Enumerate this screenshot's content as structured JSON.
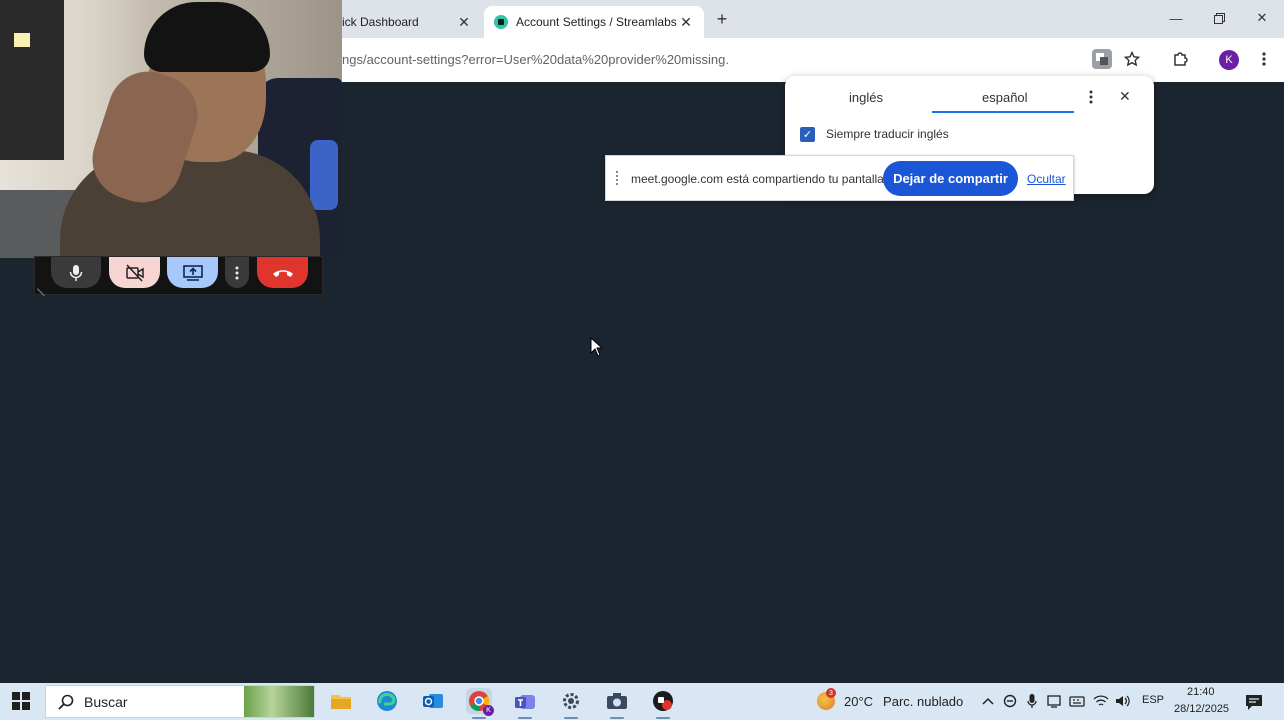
{
  "browser": {
    "tabs": [
      {
        "label": "ick Dashboard",
        "active": false
      },
      {
        "label": "Account Settings / Streamlabs",
        "active": true
      }
    ],
    "url": "ngs/account-settings?error=User%20data%20provider%20missing.",
    "avatar_letter": "K"
  },
  "translate_popup": {
    "source_lang": "inglés",
    "target_lang": "español",
    "always_translate_label": "Siempre traducir inglés",
    "always_translate_checked": true
  },
  "share_bar": {
    "message": "meet.google.com está compartiendo tu pantalla.",
    "stop_label": "Dejar de compartir",
    "hide_label": "Ocultar"
  },
  "taskbar": {
    "search_placeholder": "Buscar",
    "weather_temp": "20°C",
    "weather_condition": "Parc. nublado",
    "weather_badge": "3",
    "language": "ESP",
    "time": "21:40",
    "date": "28/12/2025"
  },
  "colors": {
    "page_background": "#1b2530",
    "accent_blue": "#1a56d6",
    "end_call_red": "#e0352c",
    "streamlabs_green": "#31c3a2"
  }
}
